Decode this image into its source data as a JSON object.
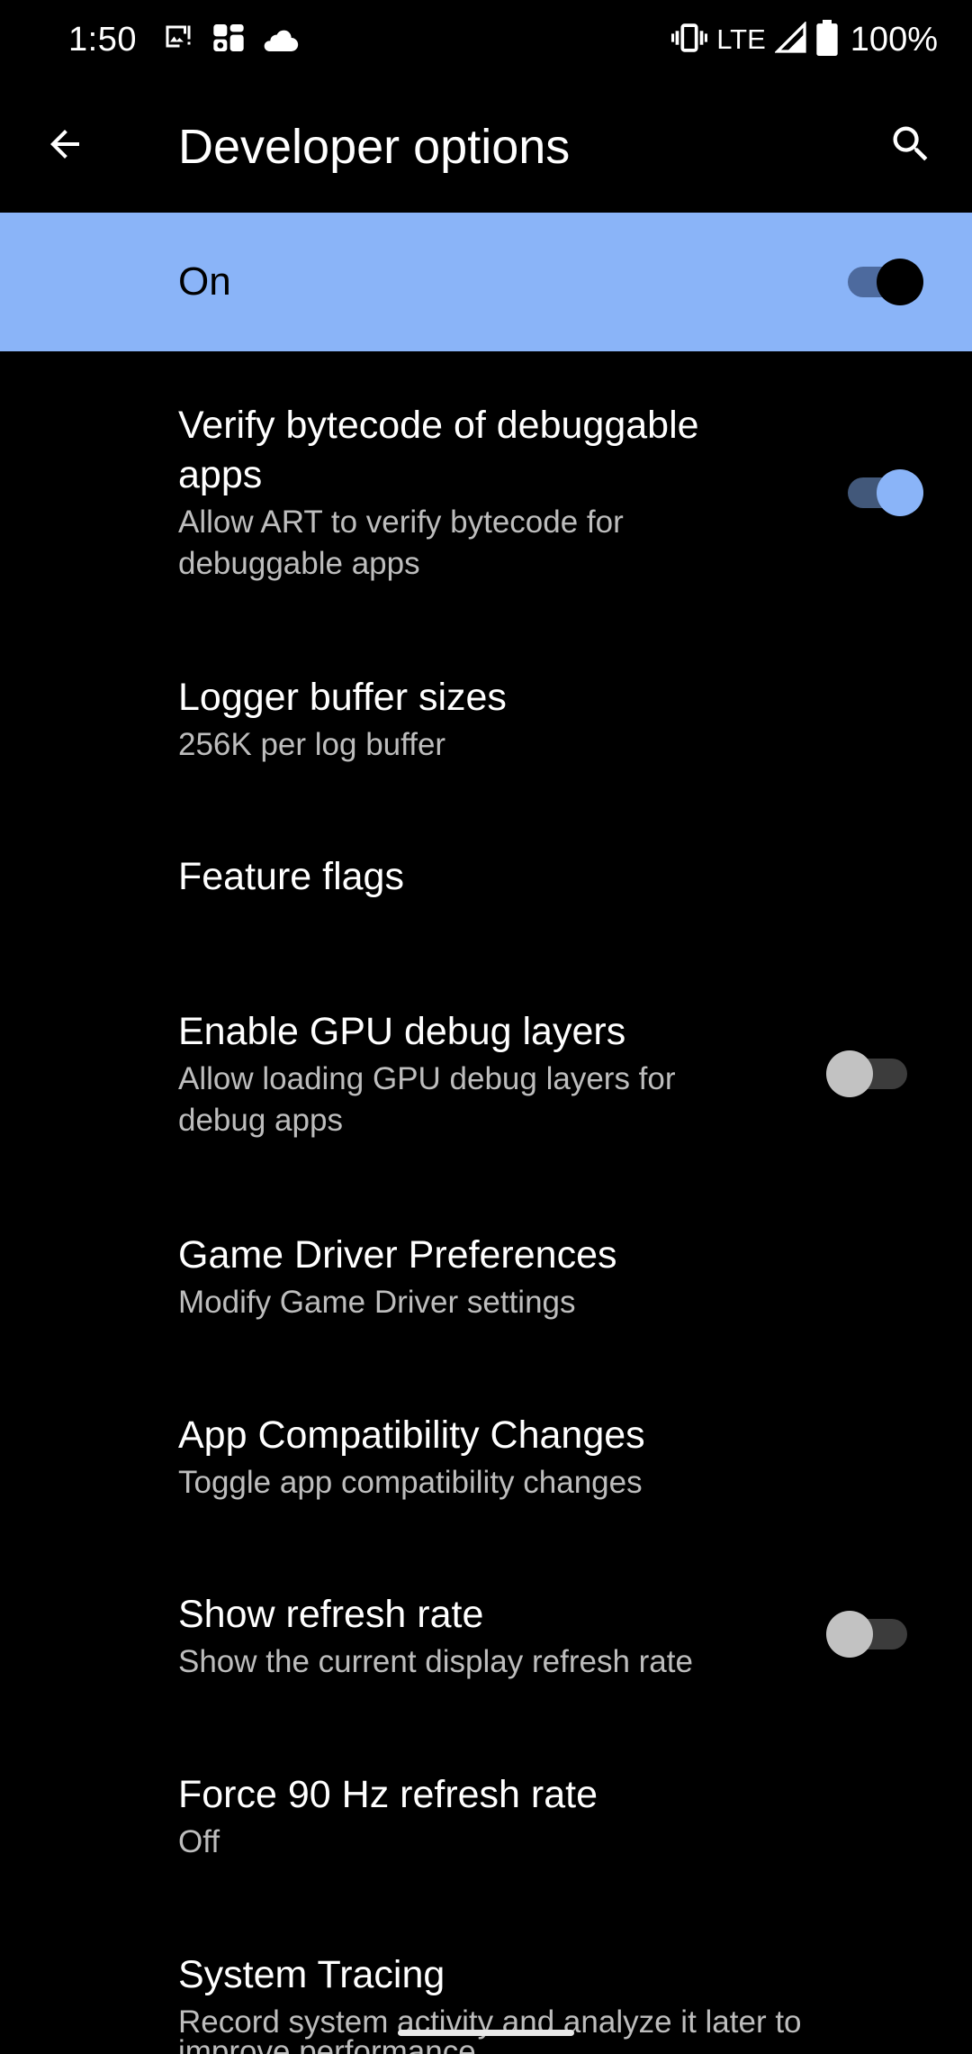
{
  "status_bar": {
    "time": "1:50",
    "left_icons": [
      "image-notification-icon",
      "news-icon",
      "cloud-icon"
    ],
    "network": "LTE",
    "battery": "100%",
    "right_icons": [
      "vibrate-icon",
      "signal-icon",
      "battery-icon"
    ]
  },
  "app_bar": {
    "title": "Developer options",
    "back_icon": "arrow-back-icon",
    "search_icon": "search-icon"
  },
  "master_switch": {
    "label": "On",
    "checked": true
  },
  "preferences": [
    {
      "title_line1": "Verify bytecode of debuggable",
      "title_line2": "apps",
      "summary_line1": "Allow ART to verify bytecode for",
      "summary_line2": "debuggable apps",
      "switch": "on"
    },
    {
      "title": "Logger buffer sizes",
      "summary": "256K per log buffer"
    },
    {
      "title": "Feature flags"
    },
    {
      "title": "Enable GPU debug layers",
      "summary_line1": "Allow loading GPU debug layers for",
      "summary_line2": "debug apps",
      "switch": "off"
    },
    {
      "title": "Game Driver Preferences",
      "summary": "Modify Game Driver settings"
    },
    {
      "title": "App Compatibility Changes",
      "summary": "Toggle app compatibility changes"
    },
    {
      "title": "Show refresh rate",
      "summary": "Show the current display refresh rate",
      "switch": "off"
    },
    {
      "title": "Force 90 Hz refresh rate",
      "summary": "Off"
    },
    {
      "title": "System Tracing",
      "summary_line1": "Record system activity and analyze it later to",
      "summary_line2": "improve performance"
    }
  ],
  "colors": {
    "background": "#000000",
    "accent": "#8ab4f8",
    "summary_text": "#bdbdbd"
  }
}
